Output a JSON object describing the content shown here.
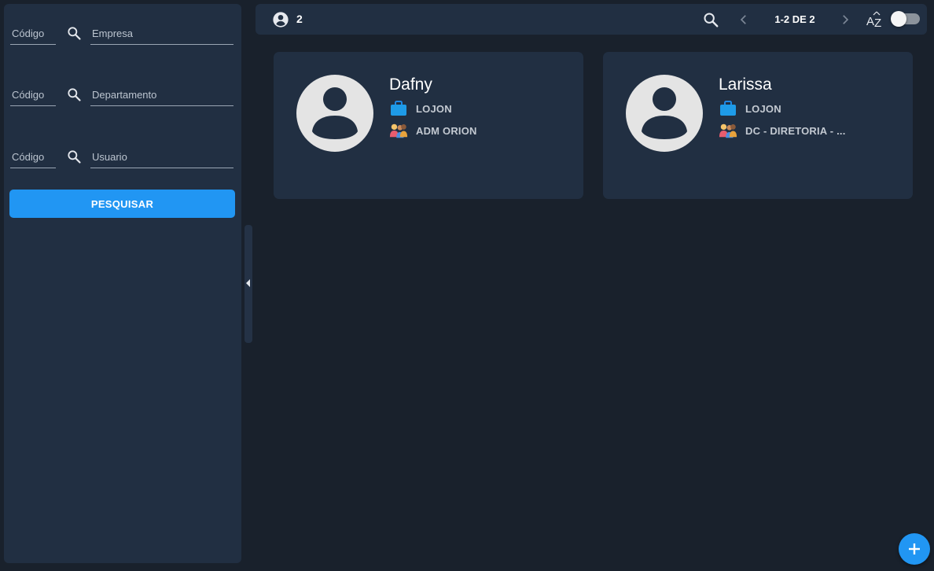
{
  "sidebar": {
    "filters": [
      {
        "code_label": "Código",
        "name_label": "Empresa"
      },
      {
        "code_label": "Código",
        "name_label": "Departamento"
      },
      {
        "code_label": "Código",
        "name_label": "Usuario"
      }
    ],
    "search_button_label": "PESQUISAR"
  },
  "topbar": {
    "count": "2",
    "pagination": "1-2 DE 2",
    "sort_icon": "sort-az-icon",
    "toggle_on": false
  },
  "cards": [
    {
      "name": "Dafny",
      "company": "LOJON",
      "department": "ADM ORION"
    },
    {
      "name": "Larissa",
      "company": "LOJON",
      "department": "DC - DIRETORIA - ..."
    }
  ],
  "colors": {
    "accent": "#2196f3",
    "panel": "#212f42",
    "background": "#19212c"
  }
}
